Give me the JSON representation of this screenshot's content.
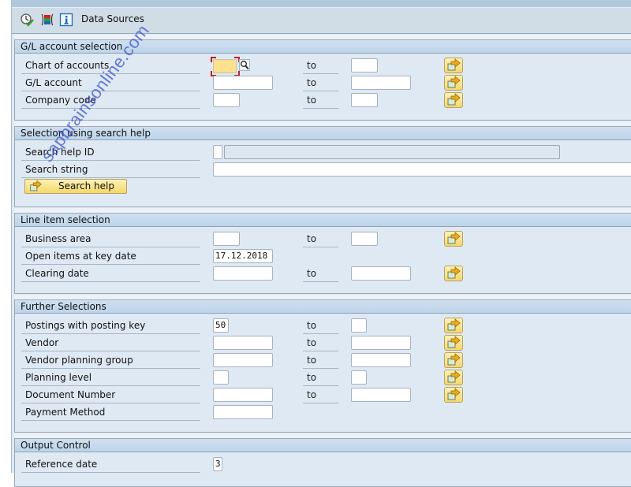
{
  "toolbar": {
    "icons": [
      "execute-icon",
      "selection-options-icon",
      "info-icon"
    ],
    "data_sources_label": "Data Sources"
  },
  "groups": {
    "gl_account": {
      "title": "G/L account selection",
      "rows": [
        {
          "label": "Chart of accounts",
          "from": "",
          "to_label": "to",
          "to": ""
        },
        {
          "label": "G/L account",
          "from": "",
          "to_label": "to",
          "to": ""
        },
        {
          "label": "Company code",
          "from": "",
          "to_label": "to",
          "to": ""
        }
      ]
    },
    "search_help": {
      "title": "Selection using search help",
      "rows": [
        {
          "label": "Search help ID",
          "value": "",
          "description": ""
        },
        {
          "label": "Search string",
          "value": ""
        }
      ],
      "button_label": "Search help"
    },
    "line_item": {
      "title": "Line item selection",
      "rows": [
        {
          "label": "Business area",
          "from": "",
          "to_label": "to",
          "to": ""
        },
        {
          "label": "Open items at key date",
          "from": "17.12.2018"
        },
        {
          "label": "Clearing date",
          "from": "",
          "to_label": "to",
          "to": ""
        }
      ]
    },
    "further": {
      "title": "Further Selections",
      "rows": [
        {
          "label": "Postings with posting key",
          "from": "50",
          "to_label": "to",
          "to": ""
        },
        {
          "label": "Vendor",
          "from": "",
          "to_label": "to",
          "to": ""
        },
        {
          "label": "Vendor planning group",
          "from": "",
          "to_label": "to",
          "to": ""
        },
        {
          "label": "Planning level",
          "from": "",
          "to_label": "to",
          "to": ""
        },
        {
          "label": "Document Number",
          "from": "",
          "to_label": "to",
          "to": ""
        },
        {
          "label": "Payment Method",
          "from": ""
        }
      ]
    },
    "output": {
      "title": "Output Control",
      "rows": [
        {
          "label": "Reference date",
          "from": "3"
        }
      ]
    }
  },
  "watermark": "sapbrainsonline.com"
}
